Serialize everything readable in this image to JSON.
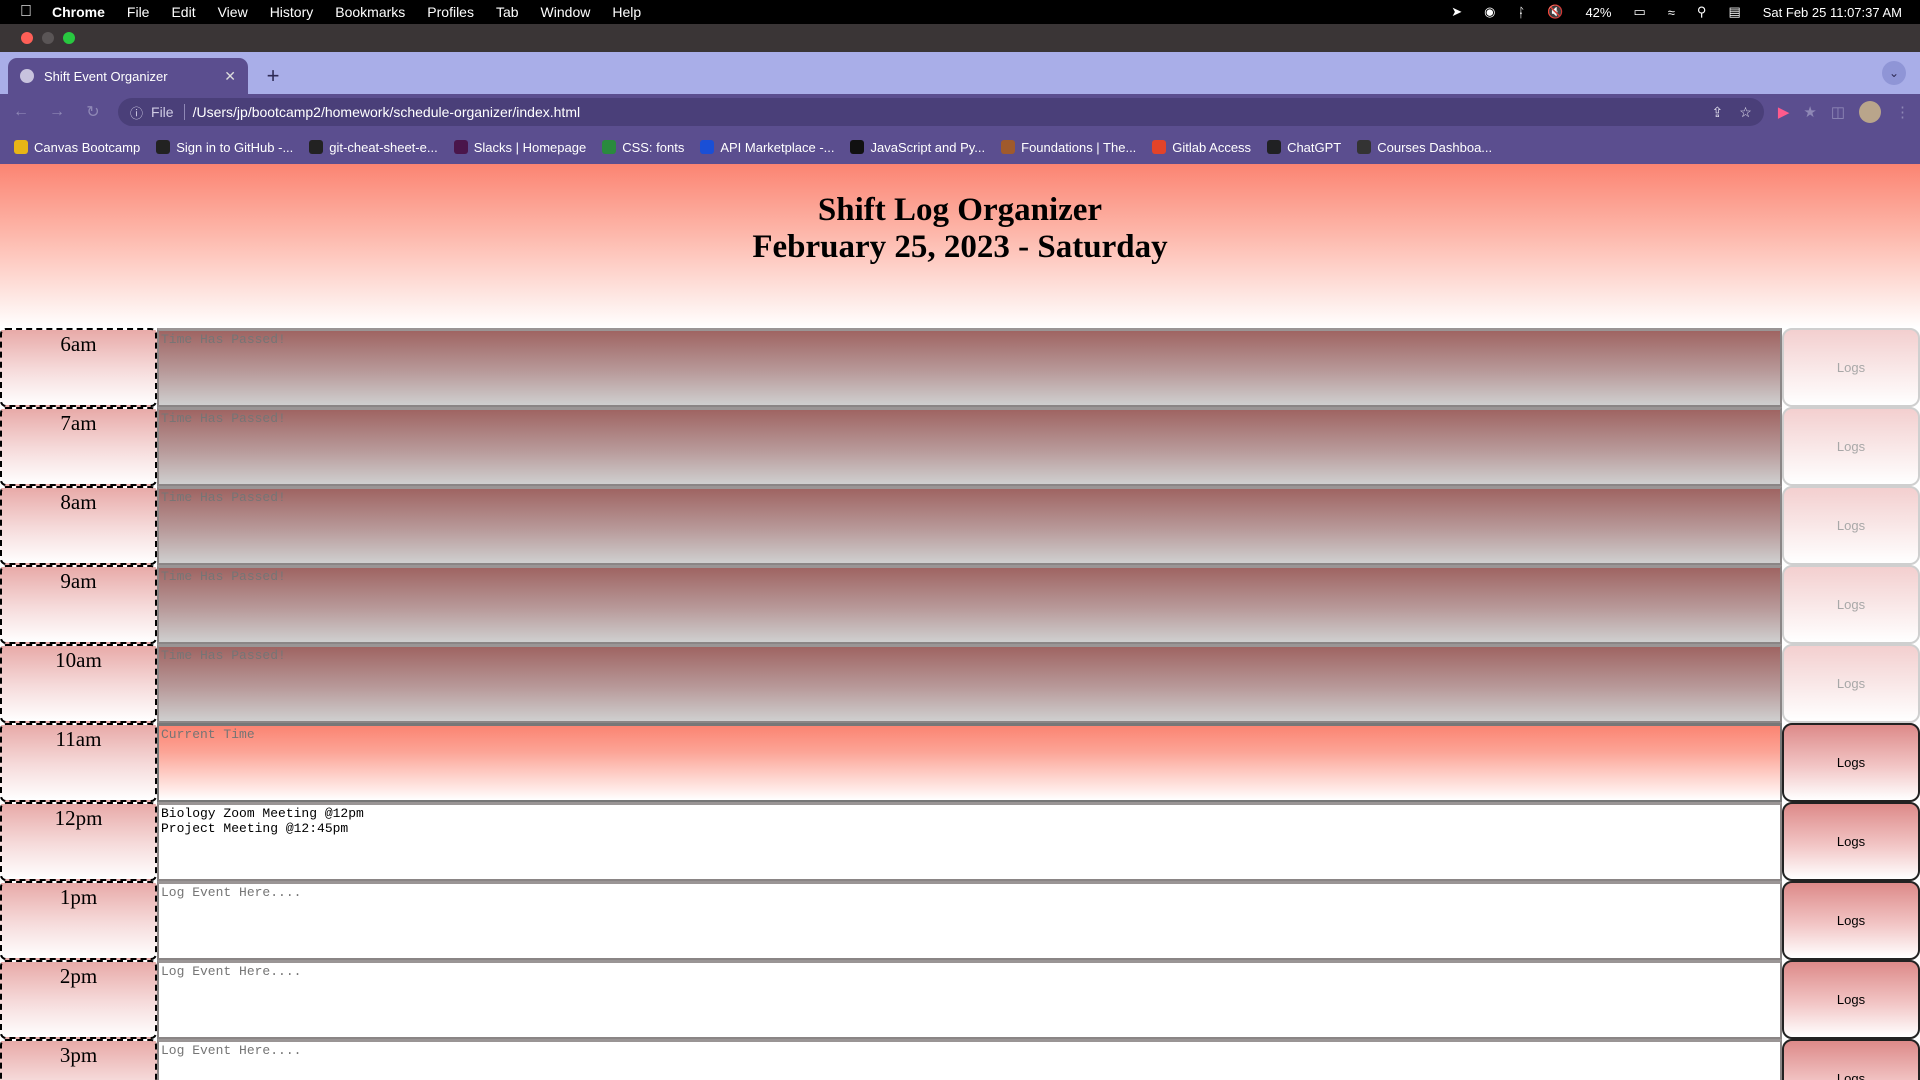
{
  "os_menu": {
    "app": "Chrome",
    "items": [
      "File",
      "Edit",
      "View",
      "History",
      "Bookmarks",
      "Profiles",
      "Tab",
      "Window",
      "Help"
    ],
    "status": {
      "battery": "42%",
      "datetime": "Sat Feb 25  11:07:37 AM"
    }
  },
  "browser": {
    "tab_title": "Shift Event Organizer",
    "scheme_label": "File",
    "url": "/Users/jp/bootcamp2/homework/schedule-organizer/index.html",
    "bookmarks": [
      {
        "label": "Canvas Bootcamp",
        "icon": "canvas-icon",
        "color": "#e8b516"
      },
      {
        "label": "Sign in to GitHub -...",
        "icon": "github-icon",
        "color": "#222222"
      },
      {
        "label": "git-cheat-sheet-e...",
        "icon": "github-icon",
        "color": "#222222"
      },
      {
        "label": "Slacks | Homepage",
        "icon": "slack-icon",
        "color": "#4a154b"
      },
      {
        "label": "CSS: fonts",
        "icon": "w3schools-icon",
        "color": "#2a8a3e"
      },
      {
        "label": "API Marketplace -...",
        "icon": "rapidapi-icon",
        "color": "#1a4fd6"
      },
      {
        "label": "JavaScript and Py...",
        "icon": "x-icon",
        "color": "#111111"
      },
      {
        "label": "Foundations | The...",
        "icon": "odin-icon",
        "color": "#a05a2c"
      },
      {
        "label": "Gitlab Access",
        "icon": "gitlab-icon",
        "color": "#e24329"
      },
      {
        "label": "ChatGPT",
        "icon": "openai-icon",
        "color": "#202123"
      },
      {
        "label": "Courses Dashboa...",
        "icon": "crown-icon",
        "color": "#333333"
      }
    ]
  },
  "page": {
    "title": "Shift Log Organizer",
    "date": "February 25, 2023 - Saturday",
    "save_label": "Logs",
    "rows": [
      {
        "hour": "6am",
        "text": "",
        "placeholder": "Time Has Passed!",
        "state": "past"
      },
      {
        "hour": "7am",
        "text": "",
        "placeholder": "Time Has Passed!",
        "state": "past"
      },
      {
        "hour": "8am",
        "text": "",
        "placeholder": "Time Has Passed!",
        "state": "past"
      },
      {
        "hour": "9am",
        "text": "",
        "placeholder": "Time Has Passed!",
        "state": "past"
      },
      {
        "hour": "10am",
        "text": "",
        "placeholder": "Time Has Passed!",
        "state": "past"
      },
      {
        "hour": "11am",
        "text": "",
        "placeholder": "Current Time",
        "state": "present"
      },
      {
        "hour": "12pm",
        "text": "Biology Zoom Meeting @12pm\nProject Meeting @12:45pm",
        "placeholder": "Log Event Here....",
        "state": "future"
      },
      {
        "hour": "1pm",
        "text": "",
        "placeholder": "Log Event Here....",
        "state": "future"
      },
      {
        "hour": "2pm",
        "text": "",
        "placeholder": "Log Event Here....",
        "state": "future"
      },
      {
        "hour": "3pm",
        "text": "",
        "placeholder": "Log Event Here....",
        "state": "future"
      }
    ]
  }
}
